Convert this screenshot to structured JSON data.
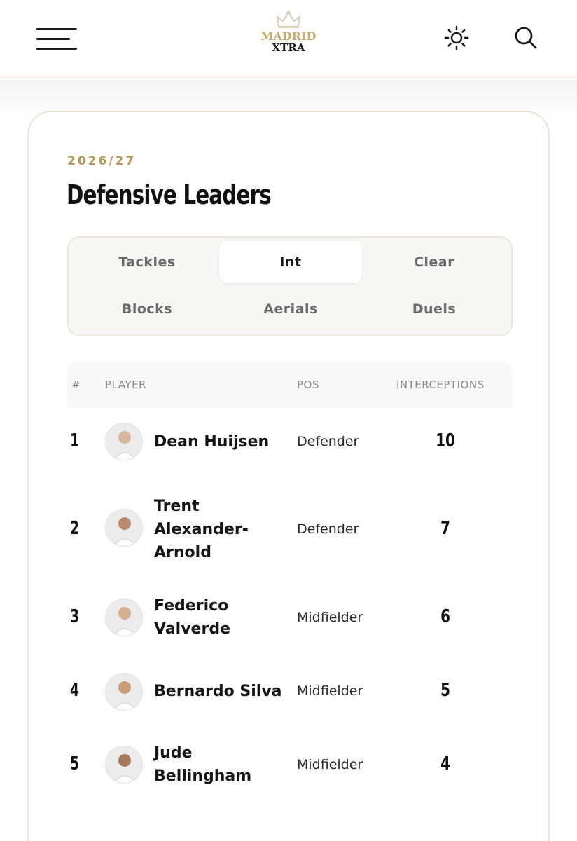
{
  "header": {
    "logo_line1": "MADRID",
    "logo_line2": "XTRA",
    "brand_gold": "#c8aa6e",
    "icons": [
      "menu-icon",
      "crown-icon",
      "sun-icon",
      "search-icon"
    ]
  },
  "card": {
    "season": "2026/27",
    "title": "Defensive Leaders"
  },
  "tabs": [
    {
      "label": "Tackles",
      "active": false
    },
    {
      "label": "Int",
      "active": true
    },
    {
      "label": "Clear",
      "active": false
    },
    {
      "label": "Blocks",
      "active": false
    },
    {
      "label": "Aerials",
      "active": false
    },
    {
      "label": "Duels",
      "active": false
    }
  ],
  "table": {
    "columns": [
      "#",
      "PLAYER",
      "POS",
      "INTERCEPTIONS"
    ],
    "rows": [
      {
        "rank": "1",
        "name": "Dean Huijsen",
        "pos": "Defender",
        "value": "10"
      },
      {
        "rank": "2",
        "name": "Trent Alexander-Arnold",
        "pos": "Defender",
        "value": "7"
      },
      {
        "rank": "3",
        "name": "Federico Valverde",
        "pos": "Midfielder",
        "value": "6"
      },
      {
        "rank": "4",
        "name": "Bernardo Silva",
        "pos": "Midfielder",
        "value": "5"
      },
      {
        "rank": "5",
        "name": "Jude Bellingham",
        "pos": "Midfielder",
        "value": "4"
      }
    ]
  }
}
